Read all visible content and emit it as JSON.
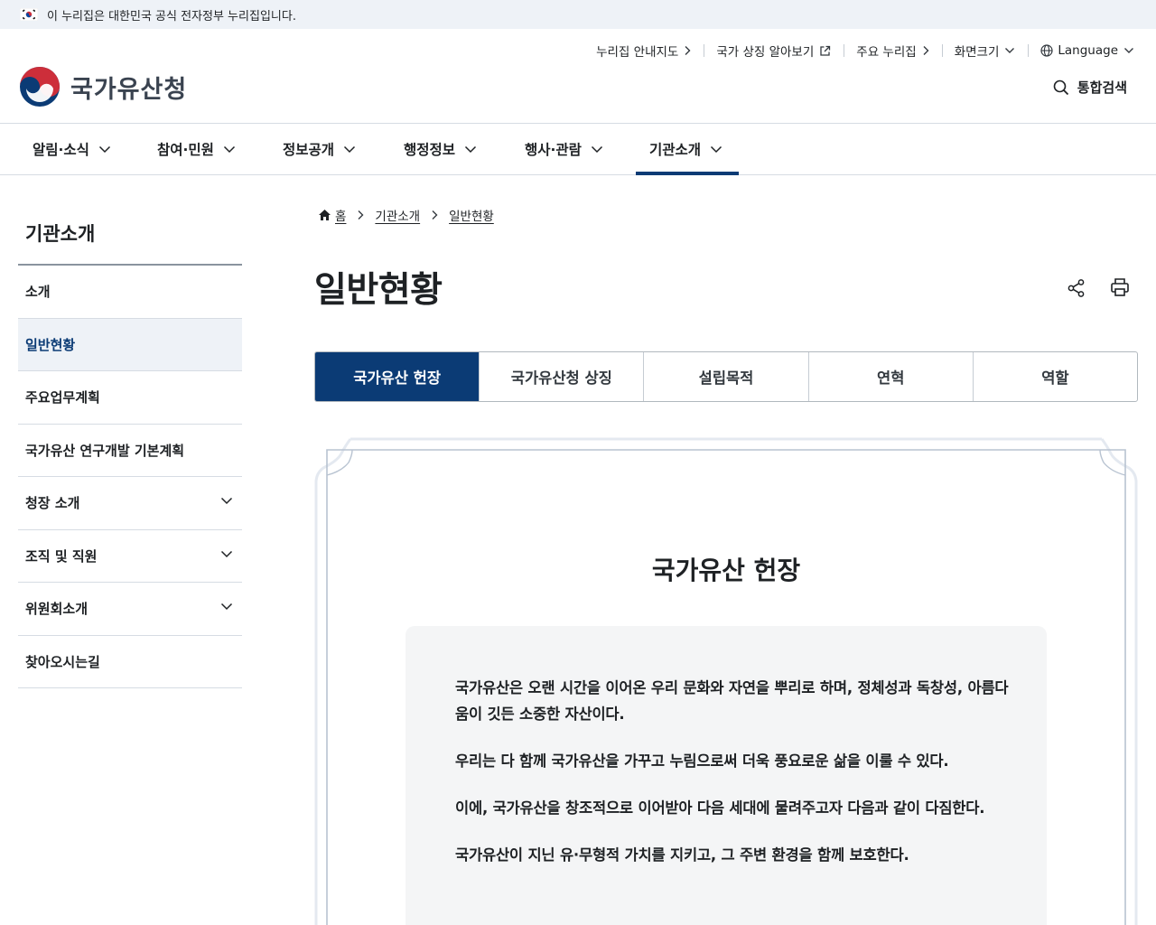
{
  "gov_banner": {
    "text": "이 누리집은 대한민국 공식 전자정부 누리집입니다."
  },
  "header": {
    "logo_text": "국가유산청",
    "util_nav": [
      {
        "label": "누리집 안내지도"
      },
      {
        "label": "국가 상징 알아보기"
      },
      {
        "label": "주요 누리집"
      },
      {
        "label": "화면크기"
      },
      {
        "label": "Language"
      }
    ],
    "search_label": "통합검색"
  },
  "gnb": [
    {
      "label": "알림·소식"
    },
    {
      "label": "참여·민원"
    },
    {
      "label": "정보공개"
    },
    {
      "label": "행정정보"
    },
    {
      "label": "행사·관람"
    },
    {
      "label": "기관소개",
      "active": true
    }
  ],
  "lnb": {
    "title": "기관소개",
    "items": [
      {
        "label": "소개"
      },
      {
        "label": "일반현황",
        "active": true
      },
      {
        "label": "주요업무계획"
      },
      {
        "label": "국가유산 연구개발 기본계획"
      },
      {
        "label": "청장 소개"
      },
      {
        "label": "조직 및 직원"
      },
      {
        "label": "위원회소개"
      },
      {
        "label": "찾아오시는길"
      }
    ]
  },
  "breadcrumb": [
    "홈",
    "기관소개",
    "일반현황"
  ],
  "page_title": "일반현황",
  "tabs": [
    {
      "label": "국가유산 헌장",
      "active": true
    },
    {
      "label": "국가유산청 상징"
    },
    {
      "label": "설립목적"
    },
    {
      "label": "연혁"
    },
    {
      "label": "역할"
    }
  ],
  "charter": {
    "title": "국가유산 헌장",
    "paragraphs": [
      "국가유산은 오랜 시간을 이어온 우리 문화와 자연을 뿌리로 하며, 정체성과 독창성, 아름다움이 깃든 소중한 자산이다.",
      "우리는 다 함께 국가유산을 가꾸고 누림으로써 더욱 풍요로운 삶을 이룰 수 있다.",
      "이에, 국가유산을 창조적으로 이어받아 다음 세대에 물려주고자 다음과 같이 다짐한다.",
      "국가유산이 지닌 유·무형적 가치를 지키고, 그 주변 환경을 함께 보호한다."
    ]
  },
  "colors": {
    "primary": "#0b3b75",
    "banner_bg": "#eef2f7",
    "charter_bg": "#f4f5f6"
  }
}
